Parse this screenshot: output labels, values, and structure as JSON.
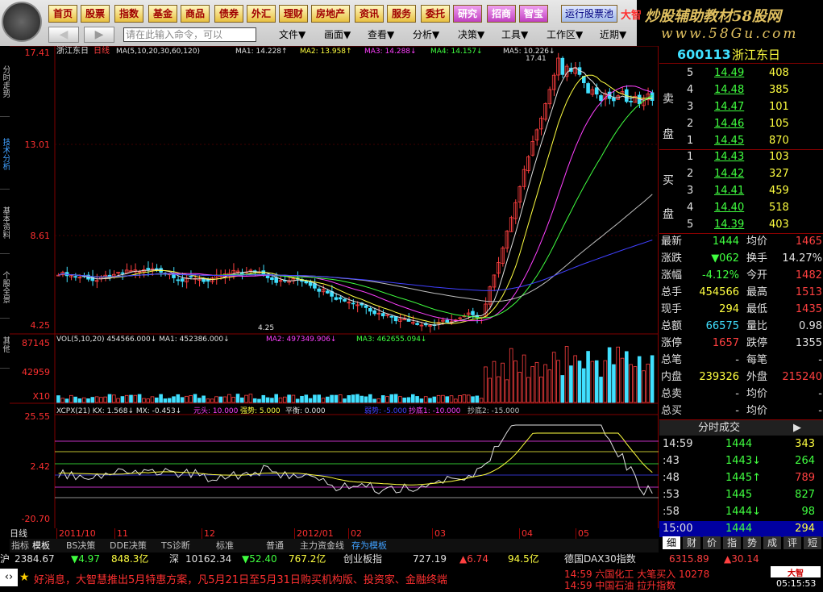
{
  "toolbar": {
    "buttons": [
      "首页",
      "股票",
      "指数",
      "基金",
      "商品",
      "债券",
      "外汇",
      "理财",
      "房地产",
      "资讯",
      "服务",
      "委托",
      "研究",
      "招商",
      "智宝"
    ],
    "run": "运行股票池",
    "menus": [
      "文件▼",
      "画面▼",
      "查看▼",
      "分析▼",
      "决策▼",
      "工具▼",
      "工作区▼",
      "近期▼"
    ],
    "cmd_placeholder": "请在此输入命令，可以"
  },
  "brand": {
    "line1": "炒股辅助教材58股网",
    "line2": "www.58Gu.com",
    "tag": "大智"
  },
  "lefttabs": [
    "分时走势",
    "技术分析",
    "基本资料",
    "个股全景",
    "其他"
  ],
  "chart": {
    "title": "浙江东日",
    "period": "日线",
    "ma_header": "MA(5,10,20,30,60,120)",
    "ma1": "MA1: 14.228↑",
    "ma2": "MA2: 13.958↑",
    "ma3": "MA3: 14.288↓",
    "ma4": "MA4: 14.157↓",
    "ma5": "MA5: 10.226↓",
    "high_label": "17.41",
    "low_label": "4.25",
    "price_axis": [
      "17.41",
      "13.01",
      "8.61",
      "4.25"
    ],
    "vol_axis": [
      "87145",
      "42959",
      "X10"
    ],
    "ind_axis": [
      "25.55",
      "2.42",
      "-20.70"
    ],
    "vol_header": "VOL(5,10,20)",
    "vol_val": "454566.000↓",
    "vma1": "MA1: 452386.000↓",
    "vma2": "MA2: 497349.906↓",
    "vma3": "MA3: 462655.094↓",
    "ind_header": "XCPX(21)",
    "kx": "KX: 1.568↓",
    "mx": "MX: -0.453↓",
    "extra": [
      "元头: 10.000",
      "强势: 5.000",
      "平衡: 0.000",
      "弱势: -5.000",
      "抄底1: -10.000",
      "抄底2: -15.000"
    ],
    "dates": [
      "2011/10",
      "11",
      "12",
      "2012/01",
      "02",
      "03",
      "04",
      "05"
    ]
  },
  "bottomtabs": [
    "指标",
    "模板",
    "BS决策",
    "DDE决策",
    "TS诊断",
    "标准",
    "普通",
    "主力资金线",
    "存为模板"
  ],
  "rpanel": {
    "code": "600113",
    "name": "浙江东日",
    "sell": [
      [
        "5",
        "14.49",
        "408"
      ],
      [
        "4",
        "14.48",
        "385"
      ],
      [
        "3",
        "14.47",
        "101"
      ],
      [
        "2",
        "14.46",
        "105"
      ],
      [
        "1",
        "14.45",
        "870"
      ]
    ],
    "buy": [
      [
        "1",
        "14.43",
        "103"
      ],
      [
        "2",
        "14.42",
        "327"
      ],
      [
        "3",
        "14.41",
        "459"
      ],
      [
        "4",
        "14.40",
        "518"
      ],
      [
        "5",
        "14.39",
        "403"
      ]
    ],
    "stats": [
      [
        "最新",
        "1444",
        "均价",
        "1465"
      ],
      [
        "涨跌",
        "▼062",
        "换手",
        "14.27%"
      ],
      [
        "涨幅",
        "-4.12%",
        "今开",
        "1482"
      ],
      [
        "总手",
        "454566",
        "最高",
        "1513"
      ],
      [
        "现手",
        "294",
        "最低",
        "1435"
      ],
      [
        "总额",
        "66575",
        "量比",
        "0.98"
      ],
      [
        "涨停",
        "1657",
        "跌停",
        "1355"
      ],
      [
        "总笔",
        "-",
        "每笔",
        "-"
      ],
      [
        "内盘",
        "239326",
        "外盘",
        "215240"
      ],
      [
        "总卖",
        "-",
        "均价",
        "-"
      ],
      [
        "总买",
        "-",
        "均价",
        "-"
      ]
    ],
    "ticks_title": "分时成交",
    "ticks": [
      [
        "14:59",
        "1444",
        "343"
      ],
      [
        ":43",
        "1443↓",
        "264"
      ],
      [
        ":48",
        "1445↑",
        "789"
      ],
      [
        ":53",
        "1445",
        "827"
      ],
      [
        ":58",
        "1444↓",
        "98"
      ],
      [
        "15:00",
        "1444",
        "294"
      ]
    ],
    "tabs": [
      "细",
      "财",
      "价",
      "指",
      "势",
      "成",
      "评",
      "短"
    ]
  },
  "status": {
    "sh": "沪",
    "sh_val": "2384.67",
    "sh_chg": "▼4.97",
    "sh_amt": "848.3亿",
    "sz": "深",
    "sz_val": "10162.34",
    "sz_chg": "▼52.40",
    "sz_amt": "767.2亿",
    "cyb": "创业板指",
    "cyb_val": "727.19",
    "cyb_chg": "▲6.74",
    "cyb_amt": "94.5亿",
    "dax": "德国DAX30指数",
    "dax_val": "6315.89",
    "dax_chg": "▲30.14"
  },
  "marquee": {
    "text": "好消息，大智慧推出5月特惠方案，凡5月21日至5月31日购买机构版、投资家、金融终端",
    "right1": "14:59 六国化工 大笔买入 10278",
    "right2": "14:59 中国石油 拉升指数",
    "time": "05:15:53"
  }
}
